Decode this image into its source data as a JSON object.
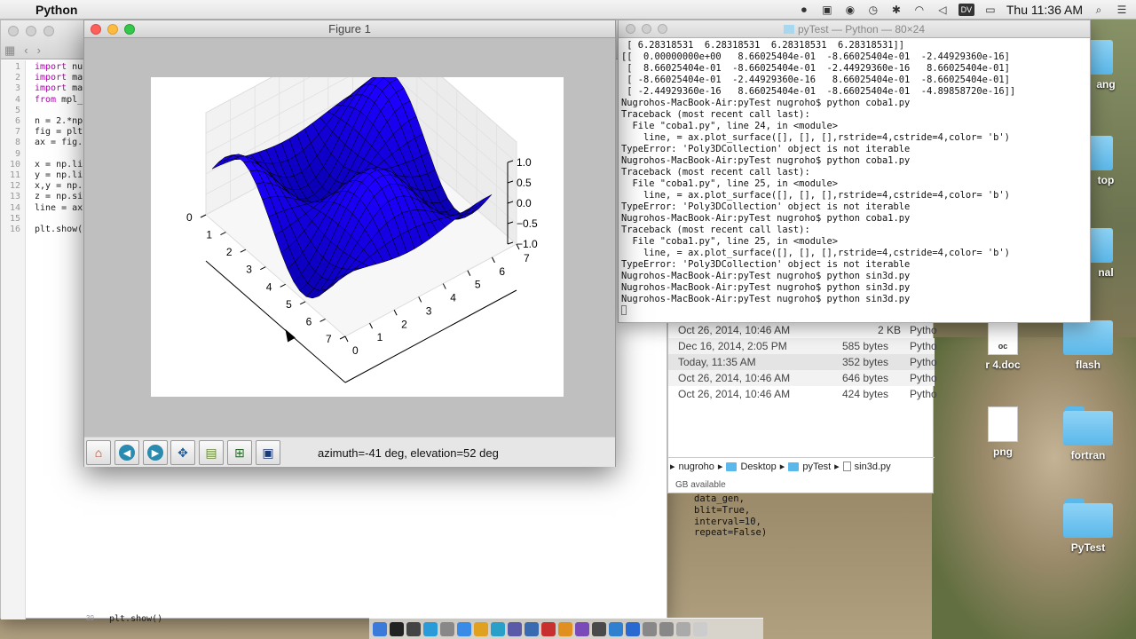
{
  "menubar": {
    "app_name": "Python",
    "clock": "Thu 11:36 AM",
    "dv_label": "DV"
  },
  "desktop_icons": [
    {
      "label": "ang",
      "kind": "folder"
    },
    {
      "label": "top",
      "kind": "folder"
    },
    {
      "label": "nal",
      "kind": "folder"
    },
    {
      "label": "flash",
      "kind": "folder"
    },
    {
      "label": "r 4.doc",
      "kind": "doc"
    },
    {
      "label": "png",
      "kind": "doc"
    },
    {
      "label": "fortran",
      "kind": "folder"
    },
    {
      "label": "PyTest",
      "kind": "folder"
    }
  ],
  "editor": {
    "lines": [
      {
        "n": "1",
        "kw": "import",
        "rest": " nu"
      },
      {
        "n": "2",
        "kw": "import",
        "rest": " ma"
      },
      {
        "n": "3",
        "kw": "import",
        "rest": " ma"
      },
      {
        "n": "4",
        "kw": "from",
        "rest": " mpl_"
      },
      {
        "n": "5",
        "kw": "",
        "rest": ""
      },
      {
        "n": "6",
        "kw": "",
        "rest": "n = 2.*np"
      },
      {
        "n": "7",
        "kw": "",
        "rest": "fig = plt"
      },
      {
        "n": "8",
        "kw": "",
        "rest": "ax = fig."
      },
      {
        "n": "9",
        "kw": "",
        "rest": ""
      },
      {
        "n": "10",
        "kw": "",
        "rest": "x = np.li"
      },
      {
        "n": "11",
        "kw": "",
        "rest": "y = np.li"
      },
      {
        "n": "12",
        "kw": "",
        "rest": "x,y = np."
      },
      {
        "n": "13",
        "kw": "",
        "rest": "z = np.si"
      },
      {
        "n": "14",
        "kw": "",
        "rest": "line = ax"
      },
      {
        "n": "15",
        "kw": "",
        "rest": ""
      },
      {
        "n": "16",
        "kw": "",
        "rest": "plt.show("
      }
    ],
    "bottom_num": "39",
    "bottom_line": "plt.show()"
  },
  "code2": "data_gen,\nblit=True,\ninterval=10,\nrepeat=False)",
  "finder": {
    "rows": [
      {
        "date": "Oct 26, 2014, 10:46 AM",
        "size": "2 KB",
        "kind": "Pytho"
      },
      {
        "date": "Dec 16, 2014, 2:05 PM",
        "size": "585 bytes",
        "kind": "Pytho"
      },
      {
        "date": "Today, 11:35 AM",
        "size": "352 bytes",
        "kind": "Pytho"
      },
      {
        "date": "Oct 26, 2014, 10:46 AM",
        "size": "646 bytes",
        "kind": "Pytho"
      },
      {
        "date": "Oct 26, 2014, 10:46 AM",
        "size": "424 bytes",
        "kind": "Pytho"
      }
    ],
    "path": [
      "nugroho",
      "Desktop",
      "pyTest",
      "sin3d.py"
    ],
    "available": "GB available"
  },
  "terminal": {
    "title": "pyTest — Python — 80×24",
    "lines": [
      " [ 6.28318531  6.28318531  6.28318531  6.28318531]]",
      "[[  0.00000000e+00   8.66025404e-01  -8.66025404e-01  -2.44929360e-16]",
      " [  8.66025404e-01  -8.66025404e-01  -2.44929360e-16   8.66025404e-01]",
      " [ -8.66025404e-01  -2.44929360e-16   8.66025404e-01  -8.66025404e-01]",
      " [ -2.44929360e-16   8.66025404e-01  -8.66025404e-01  -4.89858720e-16]]",
      "Nugrohos-MacBook-Air:pyTest nugroho$ python coba1.py",
      "Traceback (most recent call last):",
      "  File \"coba1.py\", line 24, in <module>",
      "    line, = ax.plot_surface([], [], [],rstride=4,cstride=4,color= 'b')",
      "TypeError: 'Poly3DCollection' object is not iterable",
      "Nugrohos-MacBook-Air:pyTest nugroho$ python coba1.py",
      "Traceback (most recent call last):",
      "  File \"coba1.py\", line 25, in <module>",
      "    line, = ax.plot_surface([], [], [],rstride=4,cstride=4,color= 'b')",
      "TypeError: 'Poly3DCollection' object is not iterable",
      "Nugrohos-MacBook-Air:pyTest nugroho$ python coba1.py",
      "Traceback (most recent call last):",
      "  File \"coba1.py\", line 25, in <module>",
      "    line, = ax.plot_surface([], [], [],rstride=4,cstride=4,color= 'b')",
      "TypeError: 'Poly3DCollection' object is not iterable",
      "Nugrohos-MacBook-Air:pyTest nugroho$ python sin3d.py",
      "Nugrohos-MacBook-Air:pyTest nugroho$ python sin3d.py",
      "Nugrohos-MacBook-Air:pyTest nugroho$ python sin3d.py"
    ]
  },
  "figure": {
    "title": "Figure 1",
    "status": "azimuth=-41 deg, elevation=52 deg",
    "toolbar": [
      {
        "name": "home-button",
        "icon": "home-icon"
      },
      {
        "name": "back-button",
        "icon": "back-arrow-icon"
      },
      {
        "name": "forward-button",
        "icon": "forward-arrow-icon"
      },
      {
        "name": "pan-button",
        "icon": "pan-arrows-icon"
      },
      {
        "name": "zoom-button",
        "icon": "zoom-rect-icon"
      },
      {
        "name": "subplots-button",
        "icon": "subplots-icon"
      },
      {
        "name": "save-button",
        "icon": "save-disk-icon"
      }
    ]
  },
  "chart_data": {
    "type": "surface3d",
    "surface_color": "#1a00e0",
    "x_ticks": [
      "0",
      "1",
      "2",
      "3",
      "4",
      "5",
      "6",
      "7"
    ],
    "y_ticks": [
      "0",
      "1",
      "2",
      "3",
      "4",
      "5",
      "6",
      "7"
    ],
    "z_ticks": [
      "1.0",
      "0.5",
      "0.0",
      "−0.5",
      "−1.0"
    ],
    "xlim": [
      0,
      7
    ],
    "ylim": [
      0,
      7
    ],
    "zlim": [
      -1,
      1
    ],
    "grid": true,
    "view": {
      "azimuth": -41,
      "elevation": 52
    }
  }
}
